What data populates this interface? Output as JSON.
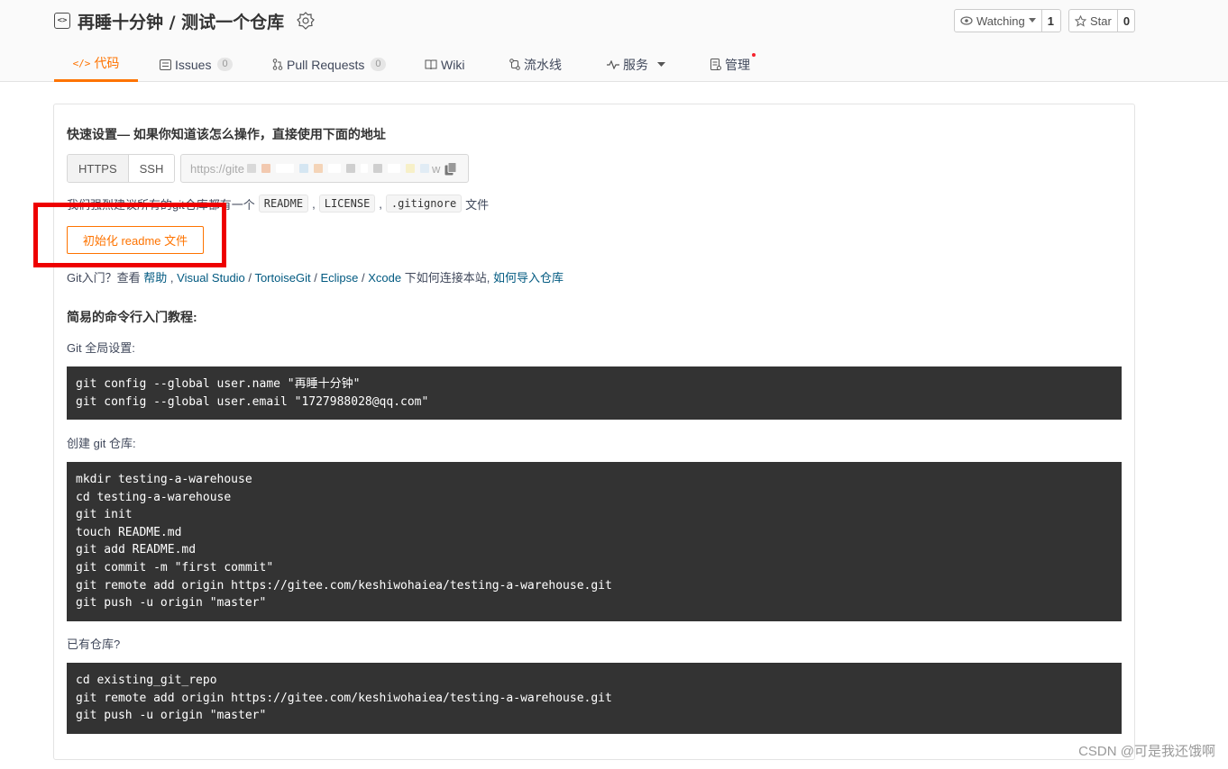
{
  "repo": {
    "icon_glyph": "<>",
    "title": "再睡十分钟 / 测试一个仓库",
    "badge_icon": "award-icon"
  },
  "watch": {
    "label": "Watching",
    "count": "1"
  },
  "star": {
    "label": "Star",
    "count": "0"
  },
  "nav": {
    "code": {
      "icon": "</>",
      "label": "代码"
    },
    "issues": {
      "label": "Issues",
      "count": "0"
    },
    "pulls": {
      "label": "Pull Requests",
      "count": "0"
    },
    "wiki": {
      "label": "Wiki"
    },
    "pipeline": {
      "label": "流水线"
    },
    "services": {
      "label": "服务"
    },
    "manage": {
      "label": "管理"
    }
  },
  "quick": {
    "title": "快速设置— 如果你知道该怎么操作，直接使用下面的地址",
    "https": "HTTPS",
    "ssh": "SSH",
    "url_prefix": "https://gite",
    "url_suffix": "w",
    "suggest_prefix": "我们强烈建议所有的git仓库都有一个",
    "readme": "README",
    "license": "LICENSE",
    "gitignore": ".gitignore",
    "suggest_suffix": "文件",
    "sep1": ",",
    "sep2": ",",
    "init_button": "初始化 readme 文件"
  },
  "help": {
    "prefix": "Git入门？查看",
    "help_link": "帮助",
    "sep1": ",",
    "vs_link": "Visual Studio",
    "slash1": "/",
    "tortoise_link": "TortoiseGit",
    "slash2": "/",
    "eclipse_link": "Eclipse",
    "slash3": "/",
    "xcode_link": "Xcode",
    "mid": "下如何连接本站,",
    "import_link": "如何导入仓库"
  },
  "tutorial": {
    "title": "简易的命令行入门教程:",
    "global_label": "Git 全局设置:",
    "global_code": [
      "git config --global user.name \"再睡十分钟\"",
      "git config --global user.email \"1727988028@qq.com\""
    ],
    "create_label": "创建 git 仓库:",
    "create_code": [
      "mkdir testing-a-warehouse",
      "cd testing-a-warehouse",
      "git init",
      "touch README.md",
      "git add README.md",
      "git commit -m \"first commit\"",
      "git remote add origin https://gitee.com/keshiwohaiea/testing-a-warehouse.git",
      "git push -u origin \"master\""
    ],
    "existing_label": "已有仓库?",
    "existing_code": [
      "cd existing_git_repo",
      "git remote add origin https://gitee.com/keshiwohaiea/testing-a-warehouse.git",
      "git push -u origin \"master\""
    ]
  },
  "watermark": "CSDN @可是我还饿啊",
  "colors": {
    "accent": "#fe7300",
    "highlight": "#ee0000",
    "code_bg": "#333333",
    "link": "#005980"
  }
}
